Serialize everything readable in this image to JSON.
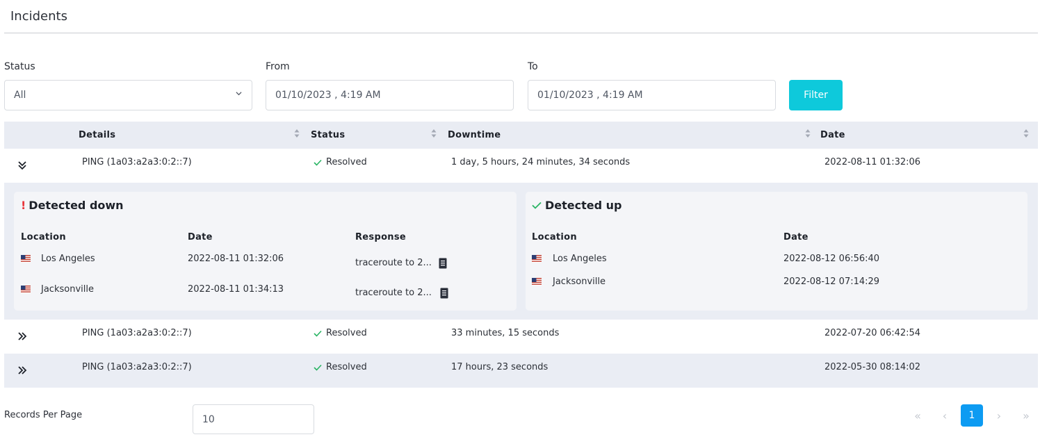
{
  "page": {
    "title": "Incidents"
  },
  "filters": {
    "status_label": "Status",
    "status_value": "All",
    "from_label": "From",
    "from_value": "01/10/2023 , 4:19 AM",
    "to_label": "To",
    "to_value": "01/10/2023 , 4:19 AM",
    "filter_button": "Filter"
  },
  "table": {
    "headers": {
      "details": "Details",
      "status": "Status",
      "downtime": "Downtime",
      "date": "Date"
    },
    "rows": [
      {
        "details": "PING (1a03:a2a3:0:2::7)",
        "status": "Resolved",
        "downtime": "1 day, 5 hours, 24 minutes, 34 seconds",
        "date": "2022-08-11 01:32:06",
        "expanded": true
      },
      {
        "details": "PING (1a03:a2a3:0:2::7)",
        "status": "Resolved",
        "downtime": "33 minutes, 15 seconds",
        "date": "2022-07-20 06:42:54",
        "expanded": false
      },
      {
        "details": "PING (1a03:a2a3:0:2::7)",
        "status": "Resolved",
        "downtime": "17 hours, 23 seconds",
        "date": "2022-05-30 08:14:02",
        "expanded": false
      }
    ]
  },
  "detected_down": {
    "title": "Detected down",
    "headers": {
      "location": "Location",
      "date": "Date",
      "response": "Response"
    },
    "rows": [
      {
        "location": "Los Angeles",
        "date": "2022-08-11 01:32:06",
        "response": "traceroute to 2..."
      },
      {
        "location": "Jacksonville",
        "date": "2022-08-11 01:34:13",
        "response": "traceroute to 2..."
      }
    ]
  },
  "detected_up": {
    "title": "Detected up",
    "headers": {
      "location": "Location",
      "date": "Date"
    },
    "rows": [
      {
        "location": "Los Angeles",
        "date": "2022-08-12 06:56:40"
      },
      {
        "location": "Jacksonville",
        "date": "2022-08-12 07:14:29"
      }
    ]
  },
  "pagination": {
    "records_per_page_label": "Records Per Page",
    "records_per_page_value": "10",
    "current_page": "1",
    "first_icon": "«",
    "prev_icon": "‹",
    "next_icon": "›",
    "last_icon": "»"
  },
  "colors": {
    "accent": "#0ec9db",
    "active_page": "#0d9bf2",
    "resolved_check": "#28b463",
    "down_alert": "#e8363c"
  }
}
